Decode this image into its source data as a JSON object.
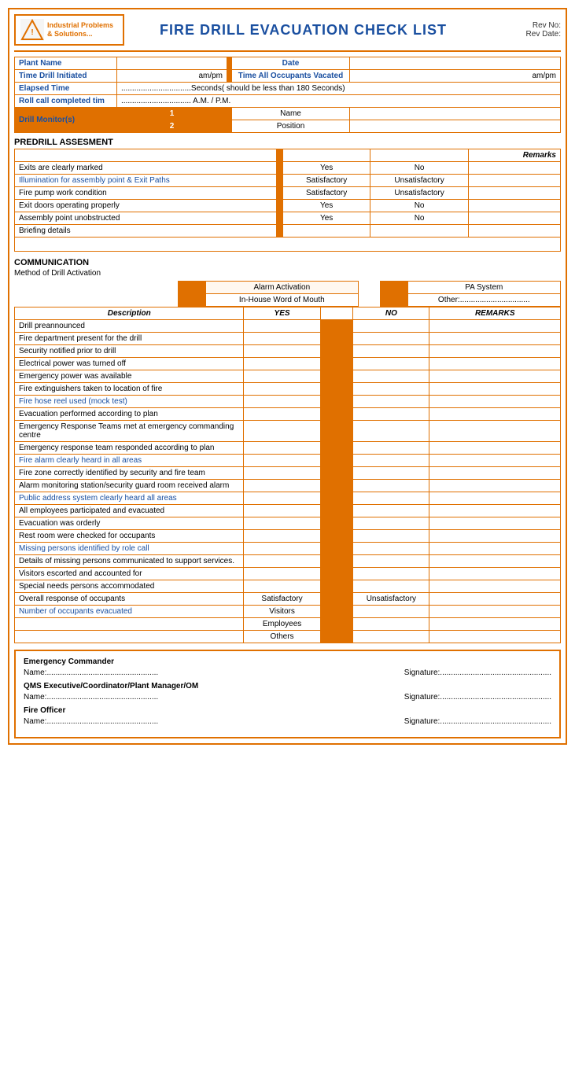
{
  "header": {
    "title": "FIRE DRILL EVACUATION CHECK LIST",
    "rev_no": "Rev No:",
    "rev_date": "Rev Date:",
    "logo_line1": "Industrial Problems",
    "logo_line2": "& Solutions..."
  },
  "info": {
    "plant_name_label": "Plant Name",
    "date_label": "Date",
    "time_drill_label": "Time Drill Initiated",
    "am_pm1": "am/pm",
    "time_vacated_label": "Time All Occupants Vacated",
    "am_pm2": "am/pm",
    "elapsed_label": "Elapsed Time",
    "elapsed_value": "................................Seconds( should be less than 180 Seconds)",
    "roll_call_label": "Roll call completed tim",
    "roll_call_value": "................................ A.M. / P.M.",
    "monitor_label": "Drill Monitor(s)",
    "monitor1_num": "1",
    "monitor1_name": "Name",
    "monitor2_num": "2",
    "monitor2_pos": "Position"
  },
  "predrill": {
    "title": "PREDRILL ASSESMENT",
    "remarks_header": "Remarks",
    "rows": [
      {
        "label": "Exits are clearly marked",
        "blue": false,
        "col1": "Yes",
        "col2": "No",
        "remarks": ""
      },
      {
        "label": "Illumination for assembly point & Exit Paths",
        "blue": true,
        "col1": "Satisfactory",
        "col2": "Unsatisfactory",
        "remarks": ""
      },
      {
        "label": "Fire pump work condition",
        "blue": false,
        "col1": "Satisfactory",
        "col2": "Unsatisfactory",
        "remarks": ""
      },
      {
        "label": "Exit doors operating properly",
        "blue": false,
        "col1": "Yes",
        "col2": "No",
        "remarks": ""
      },
      {
        "label": "Assembly point unobstructed",
        "blue": false,
        "col1": "Yes",
        "col2": "No",
        "remarks": ""
      },
      {
        "label": "Briefing details",
        "blue": false,
        "col1": "",
        "col2": "",
        "remarks": ""
      }
    ]
  },
  "communication": {
    "title": "COMMUNICATION",
    "method_label": "Method of Drill Activation",
    "option1": "Alarm Activation",
    "option2": "PA System",
    "option3": "In-House Word of Mouth",
    "option4": "Other:................................"
  },
  "checklist": {
    "headers": {
      "desc": "Description",
      "yes": "YES",
      "no": "NO",
      "remarks": "REMARKS"
    },
    "rows": [
      {
        "label": "Drill preannounced",
        "blue": false
      },
      {
        "label": "Fire department present for the drill",
        "blue": false
      },
      {
        "label": "Security notified prior to drill",
        "blue": false
      },
      {
        "label": "Electrical power was turned off",
        "blue": false
      },
      {
        "label": "Emergency power was available",
        "blue": false
      },
      {
        "label": "Fire extinguishers taken to location of fire",
        "blue": false
      },
      {
        "label": "Fire hose reel used (mock test)",
        "blue": true
      },
      {
        "label": "Evacuation performed according to plan",
        "blue": false
      },
      {
        "label": "Emergency Response Teams met at emergency commanding centre",
        "blue": false
      },
      {
        "label": "Emergency response team responded according to plan",
        "blue": false
      },
      {
        "label": "Fire alarm clearly heard in all areas",
        "blue": true
      },
      {
        "label": "Fire zone correctly identified by security and fire team",
        "blue": false
      },
      {
        "label": "Alarm monitoring station/security guard room received alarm",
        "blue": false
      },
      {
        "label": "Public address system clearly heard all areas",
        "blue": true
      },
      {
        "label": "All employees participated and evacuated",
        "blue": false
      },
      {
        "label": "Evacuation was orderly",
        "blue": false
      },
      {
        "label": "Rest room were checked for occupants",
        "blue": false
      },
      {
        "label": "Missing persons identified by role call",
        "blue": true
      },
      {
        "label": "Details of missing persons communicated to support services.",
        "blue": false
      },
      {
        "label": "Visitors escorted and accounted for",
        "blue": false
      },
      {
        "label": "Special needs persons accommodated",
        "blue": false
      },
      {
        "label": "Overall response of occupants",
        "blue": false,
        "special": "satisfactory_row"
      },
      {
        "label": "Number of occupants evacuated",
        "blue": true,
        "special": "visitors_row"
      }
    ],
    "overall_col1": "Satisfactory",
    "overall_col2": "Unsatisfactory",
    "visitors_label": "Visitors",
    "employees_label": "Employees",
    "others_label": "Others"
  },
  "signatures": {
    "roles": [
      {
        "title": "Emergency Commander",
        "name_label": "Name:...................................................",
        "sig_label": "Signature:..................................................."
      },
      {
        "title": "QMS Executive/Coordinator/Plant Manager/OM",
        "name_label": "Name:...................................................",
        "sig_label": "Signature:..................................................."
      },
      {
        "title": "Fire Officer",
        "name_label": "Name:...................................................",
        "sig_label": "Signature:..................................................."
      }
    ]
  }
}
